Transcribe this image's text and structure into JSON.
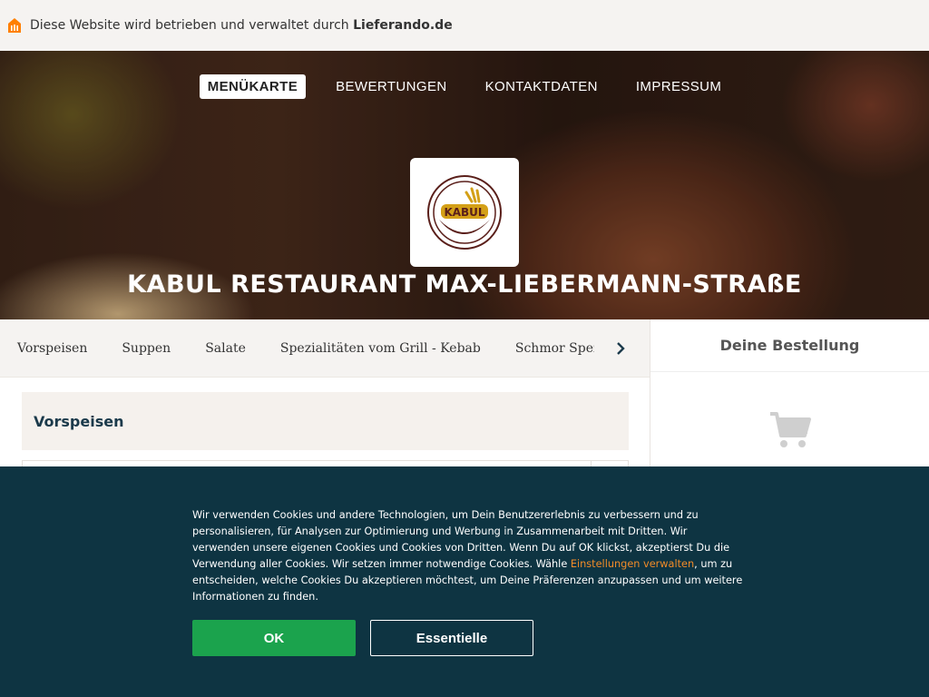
{
  "topbar": {
    "notice_prefix": "Diese Website wird betrieben und verwaltet durch",
    "notice_brand": "Lieferando.de",
    "brand_color": "#ff8000"
  },
  "nav": {
    "items": [
      {
        "label": "MENÜKARTE",
        "active": true
      },
      {
        "label": "BEWERTUNGEN",
        "active": false
      },
      {
        "label": "KONTAKTDATEN",
        "active": false
      },
      {
        "label": "IMPRESSUM",
        "active": false
      }
    ]
  },
  "restaurant": {
    "logo_text": "KABUL",
    "name": "KABUL RESTAURANT MAX-LIEBERMANN-STRAßE"
  },
  "categories": {
    "items": [
      "Vorspeisen",
      "Suppen",
      "Salate",
      "Spezialitäten vom Grill - Kebab",
      "Schmor Spezialitäten"
    ],
    "next_icon": "chevron-right-icon"
  },
  "menu": {
    "section_title": "Vorspeisen"
  },
  "order": {
    "title": "Deine Bestellung",
    "empty_icon": "cart-icon"
  },
  "cookie": {
    "text_before_link": "Wir verwenden Cookies und andere Technologien, um Dein Benutzererlebnis zu verbessern und zu personalisieren, für Analysen zur Optimierung und Werbung in Zusammenarbeit mit Dritten. Wir verwenden unsere eigenen Cookies und Cookies von Dritten. Wenn Du auf OK klickst, akzeptierst Du die Verwendung aller Cookies. Wir setzen immer notwendige Cookies. Wähle ",
    "link_text": "Einstellungen verwalten",
    "text_after_link": ", um zu entscheiden, welche Cookies Du akzeptieren möchtest, um Deine Präferenzen anzupassen und um weitere Informationen zu finden.",
    "ok_label": "OK",
    "essential_label": "Essentielle",
    "background_color": "#0e3442",
    "ok_color": "#1ba34d",
    "link_color": "#f28c28"
  }
}
